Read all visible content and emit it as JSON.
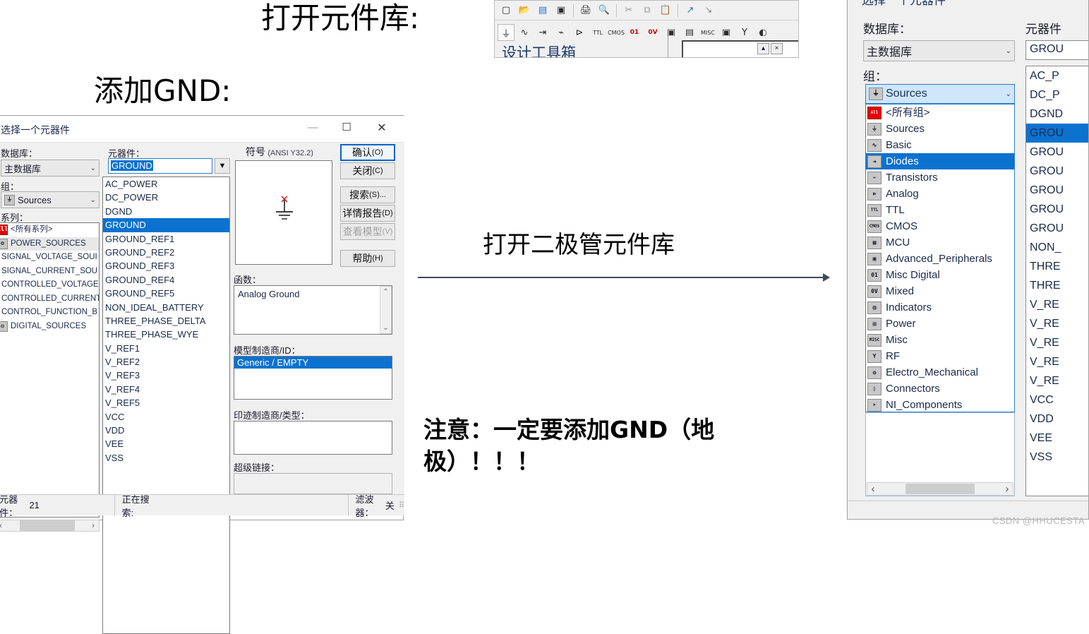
{
  "annotations": {
    "open_library": "打开元件库:",
    "add_gnd": "添加GND:",
    "open_diode_library": "打开二极管元件库",
    "warning": "注意：一定要添加GND（地极）！！！"
  },
  "watermark": "CSDN @HHUCESTA",
  "toolbar": {
    "design_toolbox_label": "设计工具箱",
    "row1_icons": [
      "new-file-icon",
      "open-folder-icon",
      "open-design-icon",
      "save-icon",
      "print-icon",
      "print-preview-icon",
      "cut-icon",
      "copy-icon",
      "paste-icon",
      "undo-icon",
      "redo-icon"
    ],
    "row2_icons": [
      "sources-icon",
      "basic-icon",
      "diodes-icon",
      "transistors-icon",
      "analog-icon",
      "ttl-icon",
      "cmos-icon",
      "misc-digital-icon",
      "mixed-icon",
      "indicators-icon",
      "power-icon",
      "misc-icon",
      "advanced-peripherals-icon",
      "rf-icon",
      "electro-mechanical-icon"
    ],
    "row2_glyphs": [
      "⏚",
      "∿",
      "⇥",
      "⌁",
      "⊳",
      "TTL",
      "CMOS",
      "01",
      "0V",
      "▣",
      "▤",
      "MISC",
      "▣",
      "Y",
      "◐"
    ],
    "collapse_button": "▴",
    "close_button": "×"
  },
  "left_dialog": {
    "title": "选择一个元器件",
    "window_buttons": {
      "minimize": "—",
      "maximize": "☐",
      "close": "✕"
    },
    "database_label": "数据库：",
    "database_value": "主数据库",
    "group_label": "组：",
    "group_value": "Sources",
    "family_label": "系列：",
    "family_items": [
      {
        "label": "<所有系列>",
        "icon": "all-icon",
        "glyph": "All",
        "selected": false
      },
      {
        "label": "POWER_SOURCES",
        "icon": "power-sources-icon",
        "glyph": "⊜",
        "selected": true
      },
      {
        "label": "SIGNAL_VOLTAGE_SOUI",
        "icon": "signal-voltage-source-icon",
        "glyph": "Ⓐ",
        "selected": false
      },
      {
        "label": "SIGNAL_CURRENT_SOU",
        "icon": "signal-current-source-icon",
        "glyph": "Ⓐ",
        "selected": false
      },
      {
        "label": "CONTROLLED_VOLTAGE",
        "icon": "controlled-voltage-icon",
        "glyph": "◫",
        "selected": false
      },
      {
        "label": "CONTROLLED_CURRENT",
        "icon": "controlled-current-icon",
        "glyph": "◫",
        "selected": false
      },
      {
        "label": "CONTROL_FUNCTION_B",
        "icon": "control-function-block-icon",
        "glyph": "▥",
        "selected": false
      },
      {
        "label": "DIGITAL_SOURCES",
        "icon": "digital-sources-icon",
        "glyph": "◎",
        "selected": false
      }
    ],
    "component_label": "元器件：",
    "component_search_value": "GROUND",
    "component_filter_icon": "filter-dropdown-icon",
    "component_items": [
      "AC_POWER",
      "DC_POWER",
      "DGND",
      "GROUND",
      "GROUND_REF1",
      "GROUND_REF2",
      "GROUND_REF3",
      "GROUND_REF4",
      "GROUND_REF5",
      "NON_IDEAL_BATTERY",
      "THREE_PHASE_DELTA",
      "THREE_PHASE_WYE",
      "V_REF1",
      "V_REF2",
      "V_REF3",
      "V_REF4",
      "V_REF5",
      "VCC",
      "VDD",
      "VEE",
      "VSS"
    ],
    "component_selected": "GROUND",
    "symbol_label": "符号",
    "symbol_standard": "(ANSI Y32.2)",
    "symbol_icon": "ground-symbol-icon",
    "function_label": "函数：",
    "function_value": "Analog Ground",
    "model_label": "模型制造商/ID：",
    "model_value": "Generic / EMPTY",
    "footprint_label": "印迹制造商/类型：",
    "footprint_value": "",
    "hyperlink_label": "超级链接：",
    "hyperlink_value": "",
    "buttons": [
      {
        "name": "confirm-button",
        "text": "确认",
        "mnemonic": "(O)",
        "primary": true,
        "disabled": false
      },
      {
        "name": "close-button",
        "text": "关闭",
        "mnemonic": "(C)",
        "primary": false,
        "disabled": false
      },
      {
        "name": "search-button",
        "text": "搜索",
        "mnemonic": "(S)...",
        "primary": false,
        "disabled": false
      },
      {
        "name": "detail-report-button",
        "text": "详情报告",
        "mnemonic": "(D)",
        "primary": false,
        "disabled": false
      },
      {
        "name": "view-model-button",
        "text": "查看模型",
        "mnemonic": "(V)",
        "primary": false,
        "disabled": true
      },
      {
        "name": "help-button",
        "text": "帮助",
        "mnemonic": "(H)",
        "primary": false,
        "disabled": false
      }
    ],
    "status": {
      "count_label": "元器件：",
      "count_value": "21",
      "searching_label": "正在搜索:",
      "filter_label": "滤波器：",
      "filter_value": "关"
    },
    "hscroll_arrows": {
      "left": "‹",
      "right": "›"
    }
  },
  "right_dialog": {
    "title": "选择一个元器件",
    "database_label": "数据库：",
    "database_value": "主数据库",
    "group_label": "组：",
    "group_value": "Sources",
    "group_value_icon": "sources-icon",
    "group_dropdown_open": true,
    "group_items": [
      {
        "label": "<所有组>",
        "icon": "all-icon",
        "glyph": "All",
        "selected": false
      },
      {
        "label": "Sources",
        "icon": "sources-icon",
        "glyph": "⏚",
        "selected": false
      },
      {
        "label": "Basic",
        "icon": "basic-icon",
        "glyph": "∿",
        "selected": false
      },
      {
        "label": "Diodes",
        "icon": "diodes-icon",
        "glyph": "⇥",
        "selected": true
      },
      {
        "label": "Transistors",
        "icon": "transistors-icon",
        "glyph": "⌁",
        "selected": false
      },
      {
        "label": "Analog",
        "icon": "analog-icon",
        "glyph": "⊳",
        "selected": false
      },
      {
        "label": "TTL",
        "icon": "ttl-icon",
        "glyph": "TTL",
        "selected": false
      },
      {
        "label": "CMOS",
        "icon": "cmos-icon",
        "glyph": "CMOS",
        "selected": false
      },
      {
        "label": "MCU",
        "icon": "mcu-icon",
        "glyph": "▦",
        "selected": false
      },
      {
        "label": "Advanced_Peripherals",
        "icon": "advanced-peripherals-icon",
        "glyph": "▣",
        "selected": false
      },
      {
        "label": "Misc Digital",
        "icon": "misc-digital-icon",
        "glyph": "01",
        "selected": false
      },
      {
        "label": "Mixed",
        "icon": "mixed-icon",
        "glyph": "0V",
        "selected": false
      },
      {
        "label": "Indicators",
        "icon": "indicators-icon",
        "glyph": "▨",
        "selected": false
      },
      {
        "label": "Power",
        "icon": "power-icon",
        "glyph": "▤",
        "selected": false
      },
      {
        "label": "Misc",
        "icon": "misc-icon",
        "glyph": "MISC",
        "selected": false
      },
      {
        "label": "RF",
        "icon": "rf-icon",
        "glyph": "Y",
        "selected": false
      },
      {
        "label": "Electro_Mechanical",
        "icon": "electro-mechanical-icon",
        "glyph": "◍",
        "selected": false
      },
      {
        "label": "Connectors",
        "icon": "connectors-icon",
        "glyph": "▯",
        "selected": false
      },
      {
        "label": "NI_Components",
        "icon": "ni-components-icon",
        "glyph": "➤",
        "selected": false
      }
    ],
    "component_label": "元器件",
    "component_search_value": "GROU",
    "component_items": [
      "AC_P",
      "DC_P",
      "DGND",
      "GROU",
      "GROU",
      "GROU",
      "GROU",
      "GROU",
      "GROU",
      "NON_",
      "THRE",
      "THRE",
      "V_RE",
      "V_RE",
      "V_RE",
      "V_RE",
      "V_RE",
      "VCC",
      "VDD",
      "VEE",
      "VSS"
    ],
    "component_selected_index": 3,
    "hscroll_arrows": {
      "left": "‹",
      "right": "›"
    }
  }
}
